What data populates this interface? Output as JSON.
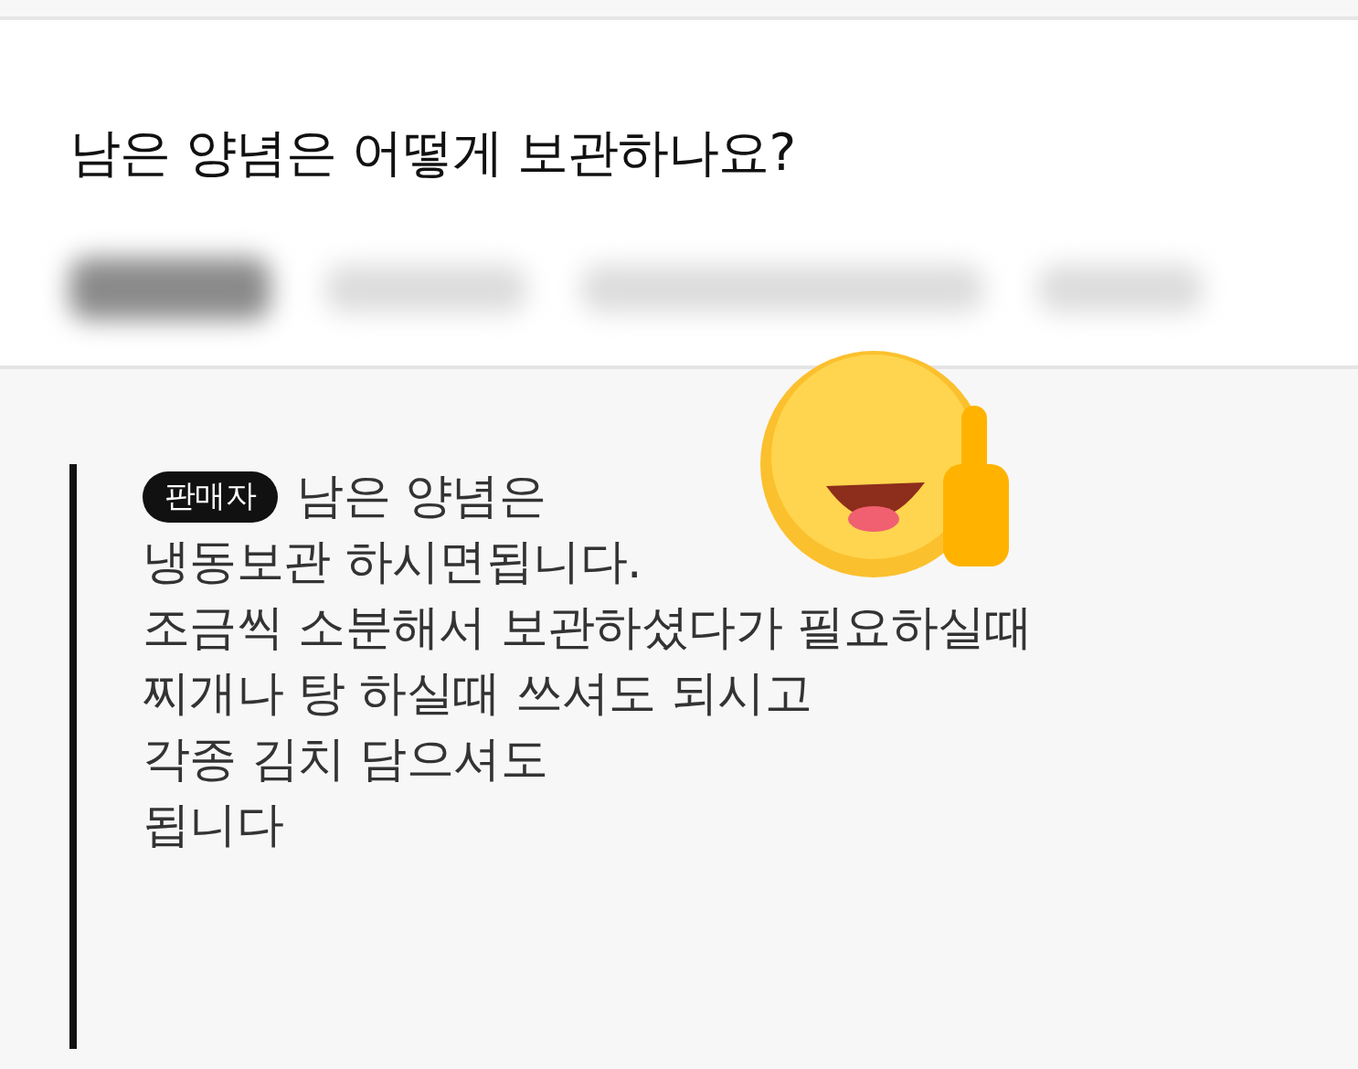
{
  "question": {
    "title": "남은 양념은 어떻게 보관하나요?"
  },
  "answer": {
    "badge": "판매자",
    "lines": [
      "남은 양념은",
      "냉동보관 하시면됩니다.",
      "조금씩 소분해서 보관하셨다가 필요하실때",
      "찌개나 탕 하실때 쓰셔도 되시고",
      "각종 김치 담으셔도",
      "됩니다"
    ]
  }
}
